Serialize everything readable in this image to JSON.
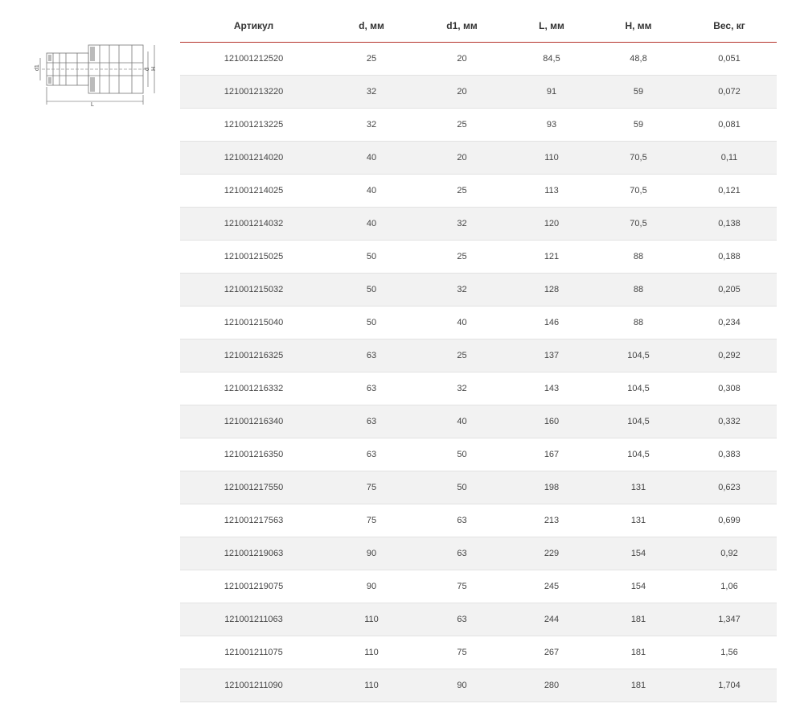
{
  "diagram": {
    "label_d1": "d1",
    "label_d": "d",
    "label_h": "H",
    "label_l": "L"
  },
  "table": {
    "headers": [
      "Артикул",
      "d, мм",
      "d1, мм",
      "L, мм",
      "H, мм",
      "Вес, кг"
    ],
    "rows": [
      [
        "121001212520",
        "25",
        "20",
        "84,5",
        "48,8",
        "0,051"
      ],
      [
        "121001213220",
        "32",
        "20",
        "91",
        "59",
        "0,072"
      ],
      [
        "121001213225",
        "32",
        "25",
        "93",
        "59",
        "0,081"
      ],
      [
        "121001214020",
        "40",
        "20",
        "110",
        "70,5",
        "0,11"
      ],
      [
        "121001214025",
        "40",
        "25",
        "113",
        "70,5",
        "0,121"
      ],
      [
        "121001214032",
        "40",
        "32",
        "120",
        "70,5",
        "0,138"
      ],
      [
        "121001215025",
        "50",
        "25",
        "121",
        "88",
        "0,188"
      ],
      [
        "121001215032",
        "50",
        "32",
        "128",
        "88",
        "0,205"
      ],
      [
        "121001215040",
        "50",
        "40",
        "146",
        "88",
        "0,234"
      ],
      [
        "121001216325",
        "63",
        "25",
        "137",
        "104,5",
        "0,292"
      ],
      [
        "121001216332",
        "63",
        "32",
        "143",
        "104,5",
        "0,308"
      ],
      [
        "121001216340",
        "63",
        "40",
        "160",
        "104,5",
        "0,332"
      ],
      [
        "121001216350",
        "63",
        "50",
        "167",
        "104,5",
        "0,383"
      ],
      [
        "121001217550",
        "75",
        "50",
        "198",
        "131",
        "0,623"
      ],
      [
        "121001217563",
        "75",
        "63",
        "213",
        "131",
        "0,699"
      ],
      [
        "121001219063",
        "90",
        "63",
        "229",
        "154",
        "0,92"
      ],
      [
        "121001219075",
        "90",
        "75",
        "245",
        "154",
        "1,06"
      ],
      [
        "121001211063",
        "110",
        "63",
        "244",
        "181",
        "1,347"
      ],
      [
        "121001211075",
        "110",
        "75",
        "267",
        "181",
        "1,56"
      ],
      [
        "121001211090",
        "110",
        "90",
        "280",
        "181",
        "1,704"
      ]
    ]
  },
  "colors": {
    "header_rule": "#b5332c",
    "row_alt": "#f2f2f2",
    "row_border": "#e2e2e2"
  }
}
